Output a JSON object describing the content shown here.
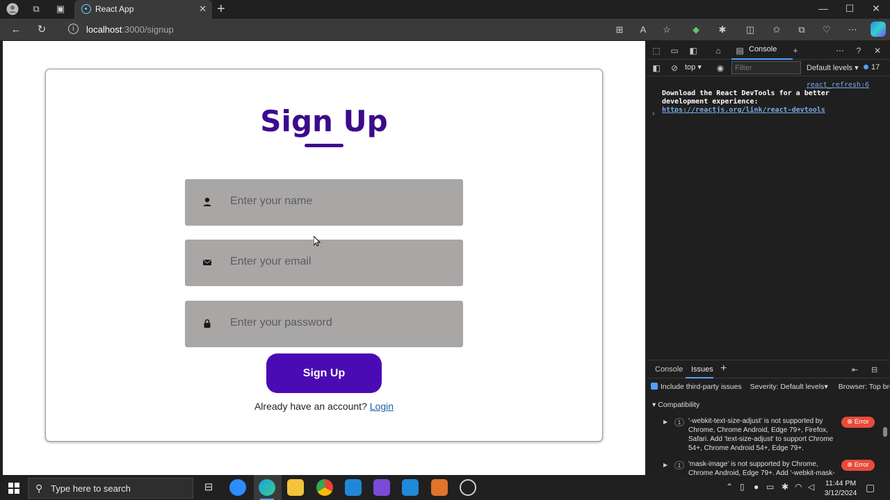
{
  "browser": {
    "tab_title": "React App",
    "url_host": "localhost",
    "url_rest": ":3000/signup"
  },
  "signup": {
    "title": "Sign Up",
    "name_placeholder": "Enter your name",
    "email_placeholder": "Enter your email",
    "password_placeholder": "Enter your password",
    "submit_label": "Sign Up",
    "already_text": "Already have an account?",
    "login_link": "Login",
    "accent_color": "#3c0b8c",
    "button_color": "#4b0bb4"
  },
  "devtools": {
    "console_tab": "Console",
    "context": "top ▾",
    "filter_placeholder": "Filter",
    "levels": "Default levels ▾",
    "message_count": "17",
    "log_source": "react_refresh:6",
    "log_message": "Download the React DevTools for a better development experience: ",
    "log_link": "https://reactjs.org/link/react-devtools",
    "bottom_tabs": [
      "Console",
      "Issues"
    ],
    "include_third_party": "Include third-party issues",
    "severity": "Severity: Default levels▾",
    "browser_filter": "Browser: Top brow",
    "compat_header": "Compatibility",
    "issues": [
      {
        "count": "1",
        "text": "'-webkit-text-size-adjust' is not supported by Chrome, Chrome Android, Edge 79+, Firefox, Safari. Add 'text-size-adjust' to support Chrome 54+, Chrome Android 54+, Edge 79+.",
        "level": "Error"
      },
      {
        "count": "1",
        "text": "'mask-image' is not supported by Chrome, Chrome Android, Edge 79+. Add '-webkit-mask-",
        "level": "Error"
      }
    ]
  },
  "taskbar": {
    "search_placeholder": "Type here to search",
    "time": "11:44 PM",
    "date": "3/12/2024"
  }
}
